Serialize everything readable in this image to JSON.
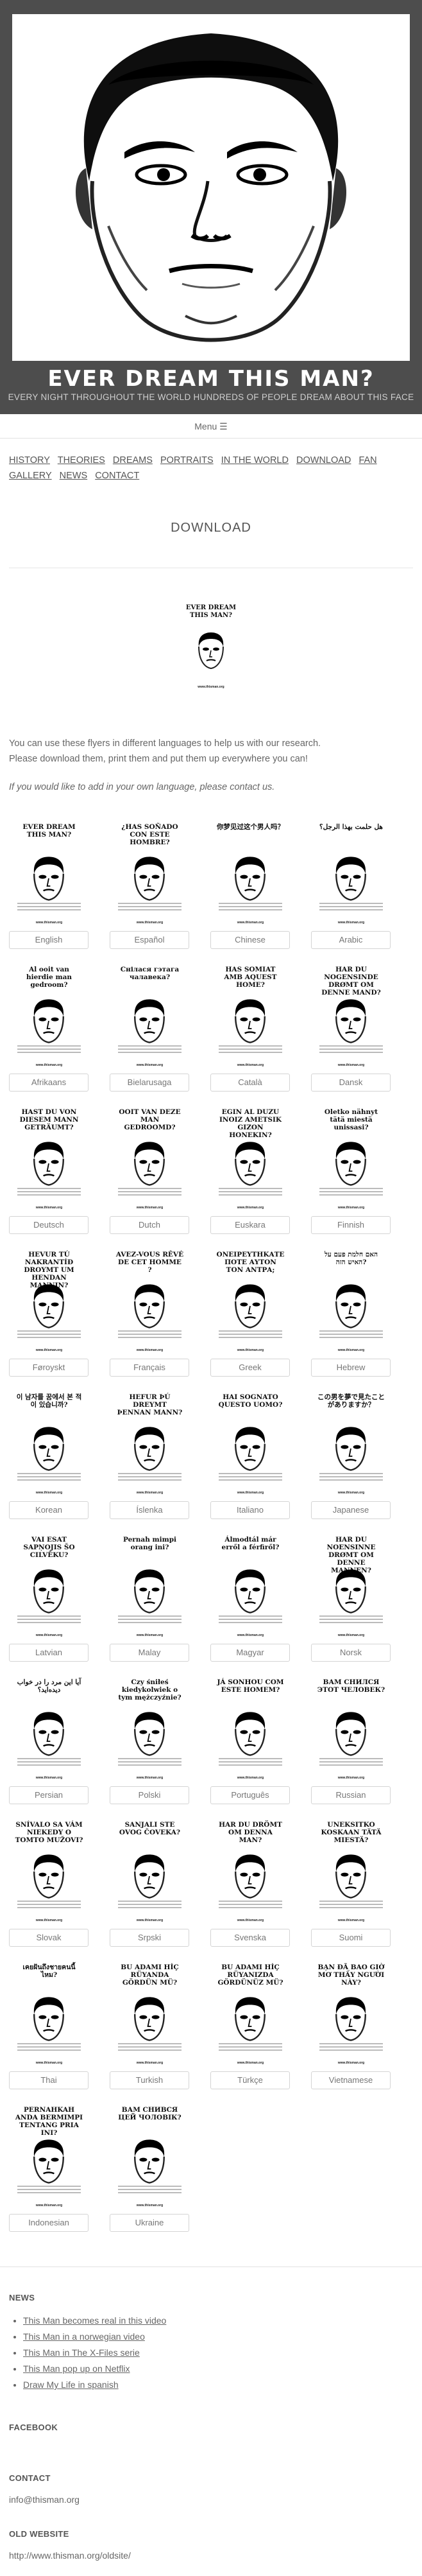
{
  "header": {
    "title": "EVER DREAM THIS MAN?",
    "subtitle": "EVERY NIGHT THROUGHOUT THE WORLD HUNDREDS OF PEOPLE DREAM ABOUT THIS FACE"
  },
  "menu": {
    "label": "Menu ☰"
  },
  "nav": {
    "items": [
      "HISTORY",
      "THEORIES",
      "DREAMS",
      "PORTRAITS",
      "IN THE WORLD",
      "DOWNLOAD",
      "FAN GALLERY",
      "NEWS",
      "CONTACT"
    ]
  },
  "page_title": "DOWNLOAD",
  "main_flyer": {
    "title": "EVER DREAM THIS MAN?",
    "url": "www.thisman.org"
  },
  "intro": {
    "line1": "You can use these flyers in different languages to help us with our research.",
    "line2": "Please download them, print them and put them up everywhere you can!",
    "note": "If you would like to add in your own language, please contact us."
  },
  "flyers": [
    {
      "title": "EVER DREAM THIS MAN?",
      "lang": "English"
    },
    {
      "title": "¿HAS SOÑADO CON ESTE HOMBRE?",
      "lang": "Español"
    },
    {
      "title": "你梦见过这个男人吗？",
      "lang": "Chinese"
    },
    {
      "title": "هل حلمت بهذا الرجل؟",
      "lang": "Arabic"
    },
    {
      "title": "Al ooit van hierdie man gedroom?",
      "lang": "Afrikaans"
    },
    {
      "title": "Снілася гэтага чалавека?",
      "lang": "Bielarusaga"
    },
    {
      "title": "HAS SOMIAT AMB AQUEST HOME?",
      "lang": "Català"
    },
    {
      "title": "HAR DU NOGENSINDE DRØMT OM DENNE MAND?",
      "lang": "Dansk"
    },
    {
      "title": "HAST DU VON DIESEM MANN GETRÄUMT?",
      "lang": "Deutsch"
    },
    {
      "title": "OOIT VAN DEZE MAN GEDROOMD?",
      "lang": "Dutch"
    },
    {
      "title": "EGIN AL DUZU INOIZ AMETSIK GIZON HONEKIN?",
      "lang": "Euskara"
    },
    {
      "title": "Oletko nähnyt tätä miestä unissasi?",
      "lang": "Finnish"
    },
    {
      "title": "HEVUR TÚ NAKRANTÍÐ DROYMT UM HENDAN MANNIN?",
      "lang": "Føroyskt"
    },
    {
      "title": "AVEZ-VOUS RÊVÉ DE CET HOMME ?",
      "lang": "Français"
    },
    {
      "title": "ΟΝΕΙΡΕΥΤΗΚΑΤΕ ΠΟΤΕ ΑΥΤΟΝ ΤΟΝ ΑΝΤΡΑ;",
      "lang": "Greek"
    },
    {
      "title": "האם חלמת פעם על האיש הזה?",
      "lang": "Hebrew"
    },
    {
      "title": "이 남자를 꿈에서 본 적이 있습니까?",
      "lang": "Korean"
    },
    {
      "title": "HEFUR ÞÚ DREYMT ÞENNAN MANN?",
      "lang": "Íslenka"
    },
    {
      "title": "HAI SOGNATO QUESTO UOMO?",
      "lang": "Italiano"
    },
    {
      "title": "この男を夢で見たことがありますか？",
      "lang": "Japanese"
    },
    {
      "title": "VAI ESAT SAPŅOJIS ŠO CILVĒKU?",
      "lang": "Latvian"
    },
    {
      "title": "Pernah mimpi orang ini?",
      "lang": "Malay"
    },
    {
      "title": "Álmodtál már erről a férfiről?",
      "lang": "Magyar"
    },
    {
      "title": "HAR DU NOENSINNE DRØMT OM DENNE MANNEN?",
      "lang": "Norsk"
    },
    {
      "title": "آیا این مرد را در خواب دیده‌اید؟",
      "lang": "Persian"
    },
    {
      "title": "Czy śniłeś kiedykolwiek o tym mężczyźnie?",
      "lang": "Polski"
    },
    {
      "title": "JÁ SONHOU COM ESTE HOMEM?",
      "lang": "Português"
    },
    {
      "title": "ВАМ СНИЛСЯ ЭТОТ ЧЕЛОВЕК?",
      "lang": "Russian"
    },
    {
      "title": "SNÍVALO SA VÁM NIEKEDY O TOMTO MUŽOVI?",
      "lang": "Slovak"
    },
    {
      "title": "SANJALI STE OVOG ČOVEKA?",
      "lang": "Srpski"
    },
    {
      "title": "HAR DU DRÖMT OM DENNA MAN?",
      "lang": "Svenska"
    },
    {
      "title": "UNEKSITKO KOSKAAN TÄTÄ MIESTÄ?",
      "lang": "Suomi"
    },
    {
      "title": "เคยฝันถึงชายคนนี้ไหม?",
      "lang": "Thai"
    },
    {
      "title": "BU ADAMI HİÇ RÜYANDA GÖRDÜN MÜ?",
      "lang": "Turkish"
    },
    {
      "title": "BU ADAMI HİÇ RÜYANIZDA GÖRDÜNÜZ MÜ?",
      "lang": "Türkçe"
    },
    {
      "title": "BẠN ĐÃ BAO GIỜ MƠ THẤY NGƯỜI NÀY?",
      "lang": "Vietnamese"
    },
    {
      "title": "PERNAHKAH ANDA BERMIMPI TENTANG PRIA INI?",
      "lang": "Indonesian"
    },
    {
      "title": "ВАМ СНИВСЯ ЦЕЙ ЧОЛОВІК?",
      "lang": "Ukraine"
    }
  ],
  "footer": {
    "news_title": "NEWS",
    "news": [
      "This Man becomes real in this video",
      "This Man in a norwegian video",
      "This Man in The X-Files serie",
      "This Man pop up on Netflix",
      "Draw My Life in spanish"
    ],
    "facebook_title": "FACEBOOK",
    "contact_title": "CONTACT",
    "contact_email": "info@thisman.org",
    "old_title": "OLD WEBSITE",
    "old_url": "http://www.thisman.org/oldsite/"
  }
}
